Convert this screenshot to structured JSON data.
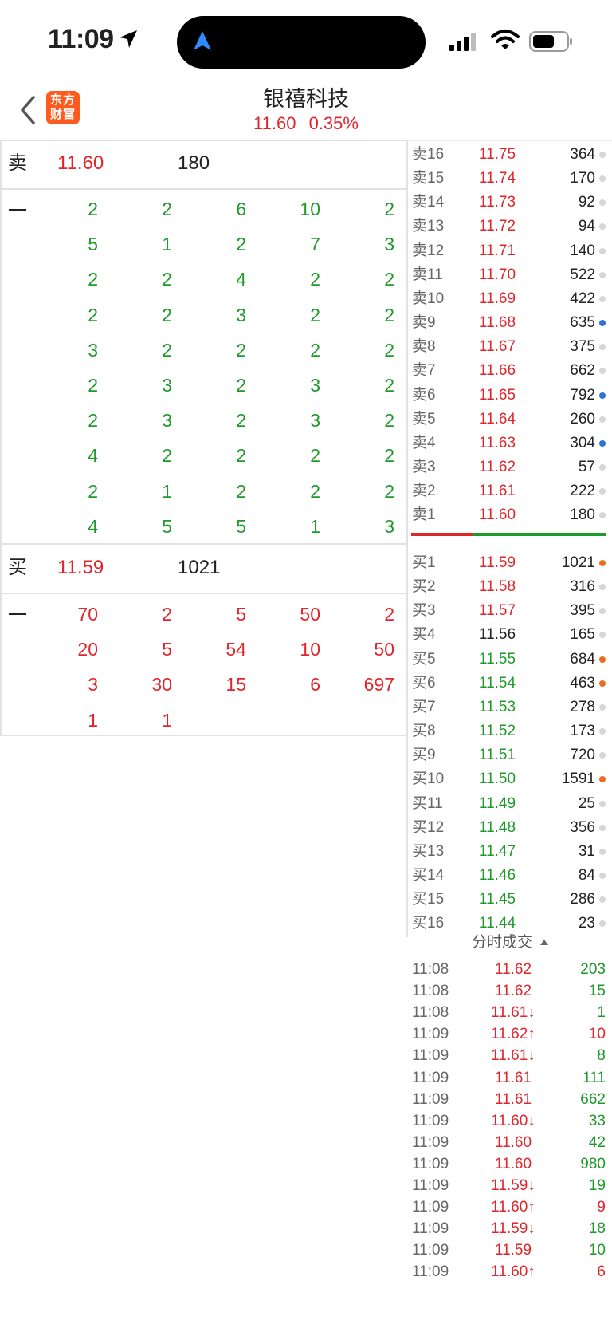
{
  "status_bar": {
    "time": "11:09"
  },
  "header": {
    "title": "银禧科技",
    "price": "11.60",
    "change_pct": "0.35%",
    "logo_line1": "东方",
    "logo_line2": "财富"
  },
  "left_panel": {
    "sell1": {
      "label": "卖一",
      "price": "11.60",
      "volume": "180",
      "orders": [
        [
          "2",
          "2",
          "6",
          "10",
          "2"
        ],
        [
          "5",
          "1",
          "2",
          "7",
          "3"
        ],
        [
          "2",
          "2",
          "4",
          "2",
          "2"
        ],
        [
          "2",
          "2",
          "3",
          "2",
          "2"
        ],
        [
          "3",
          "2",
          "2",
          "2",
          "2"
        ],
        [
          "2",
          "3",
          "2",
          "3",
          "2"
        ],
        [
          "2",
          "3",
          "2",
          "3",
          "2"
        ],
        [
          "4",
          "2",
          "2",
          "2",
          "2"
        ],
        [
          "2",
          "1",
          "2",
          "2",
          "2"
        ],
        [
          "4",
          "5",
          "5",
          "1",
          "3"
        ]
      ]
    },
    "buy1": {
      "label": "买一",
      "price": "11.59",
      "volume": "1021",
      "orders": [
        [
          "70",
          "2",
          "5",
          "50",
          "2"
        ],
        [
          "20",
          "5",
          "54",
          "10",
          "50"
        ],
        [
          "3",
          "30",
          "15",
          "6",
          "697"
        ],
        [
          "1",
          "1",
          "",
          "",
          ""
        ]
      ]
    }
  },
  "order_book": {
    "asks": [
      {
        "label": "卖16",
        "price": "11.75",
        "volume": "364",
        "dot": "gray"
      },
      {
        "label": "卖15",
        "price": "11.74",
        "volume": "170",
        "dot": "gray"
      },
      {
        "label": "卖14",
        "price": "11.73",
        "volume": "92",
        "dot": "gray"
      },
      {
        "label": "卖13",
        "price": "11.72",
        "volume": "94",
        "dot": "gray"
      },
      {
        "label": "卖12",
        "price": "11.71",
        "volume": "140",
        "dot": "gray"
      },
      {
        "label": "卖11",
        "price": "11.70",
        "volume": "522",
        "dot": "gray"
      },
      {
        "label": "卖10",
        "price": "11.69",
        "volume": "422",
        "dot": "gray"
      },
      {
        "label": "卖9",
        "price": "11.68",
        "volume": "635",
        "dot": "blue"
      },
      {
        "label": "卖8",
        "price": "11.67",
        "volume": "375",
        "dot": "gray"
      },
      {
        "label": "卖7",
        "price": "11.66",
        "volume": "662",
        "dot": "gray"
      },
      {
        "label": "卖6",
        "price": "11.65",
        "volume": "792",
        "dot": "blue"
      },
      {
        "label": "卖5",
        "price": "11.64",
        "volume": "260",
        "dot": "gray"
      },
      {
        "label": "卖4",
        "price": "11.63",
        "volume": "304",
        "dot": "blue"
      },
      {
        "label": "卖3",
        "price": "11.62",
        "volume": "57",
        "dot": "gray"
      },
      {
        "label": "卖2",
        "price": "11.61",
        "volume": "222",
        "dot": "gray"
      },
      {
        "label": "卖1",
        "price": "11.60",
        "volume": "180",
        "dot": "gray"
      }
    ],
    "bids": [
      {
        "label": "买1",
        "price": "11.59",
        "volume": "1021",
        "dot": "orange",
        "color": "red"
      },
      {
        "label": "买2",
        "price": "11.58",
        "volume": "316",
        "dot": "gray",
        "color": "red"
      },
      {
        "label": "买3",
        "price": "11.57",
        "volume": "395",
        "dot": "gray",
        "color": "red"
      },
      {
        "label": "买4",
        "price": "11.56",
        "volume": "165",
        "dot": "gray",
        "color": "black"
      },
      {
        "label": "买5",
        "price": "11.55",
        "volume": "684",
        "dot": "orange",
        "color": "green"
      },
      {
        "label": "买6",
        "price": "11.54",
        "volume": "463",
        "dot": "orange",
        "color": "green"
      },
      {
        "label": "买7",
        "price": "11.53",
        "volume": "278",
        "dot": "gray",
        "color": "green"
      },
      {
        "label": "买8",
        "price": "11.52",
        "volume": "173",
        "dot": "gray",
        "color": "green"
      },
      {
        "label": "买9",
        "price": "11.51",
        "volume": "720",
        "dot": "gray",
        "color": "green"
      },
      {
        "label": "买10",
        "price": "11.50",
        "volume": "1591",
        "dot": "orange",
        "color": "green"
      },
      {
        "label": "买11",
        "price": "11.49",
        "volume": "25",
        "dot": "gray",
        "color": "green"
      },
      {
        "label": "买12",
        "price": "11.48",
        "volume": "356",
        "dot": "gray",
        "color": "green"
      },
      {
        "label": "买13",
        "price": "11.47",
        "volume": "31",
        "dot": "gray",
        "color": "green"
      },
      {
        "label": "买14",
        "price": "11.46",
        "volume": "84",
        "dot": "gray",
        "color": "green"
      },
      {
        "label": "买15",
        "price": "11.45",
        "volume": "286",
        "dot": "gray",
        "color": "green"
      },
      {
        "label": "买16",
        "price": "11.44",
        "volume": "23",
        "dot": "gray",
        "color": "green"
      }
    ]
  },
  "ticks": {
    "header": "分时成交",
    "rows": [
      {
        "time": "11:08",
        "price": "11.62",
        "vol": "203",
        "vcolor": "green"
      },
      {
        "time": "11:08",
        "price": "11.62",
        "vol": "15",
        "vcolor": "green"
      },
      {
        "time": "11:08",
        "price": "11.61↓",
        "vol": "1",
        "vcolor": "green"
      },
      {
        "time": "11:09",
        "price": "11.62↑",
        "vol": "10",
        "vcolor": "red"
      },
      {
        "time": "11:09",
        "price": "11.61↓",
        "vol": "8",
        "vcolor": "green"
      },
      {
        "time": "11:09",
        "price": "11.61",
        "vol": "111",
        "vcolor": "green"
      },
      {
        "time": "11:09",
        "price": "11.61",
        "vol": "662",
        "vcolor": "green"
      },
      {
        "time": "11:09",
        "price": "11.60↓",
        "vol": "33",
        "vcolor": "green"
      },
      {
        "time": "11:09",
        "price": "11.60",
        "vol": "42",
        "vcolor": "green"
      },
      {
        "time": "11:09",
        "price": "11.60",
        "vol": "980",
        "vcolor": "green"
      },
      {
        "time": "11:09",
        "price": "11.59↓",
        "vol": "19",
        "vcolor": "green"
      },
      {
        "time": "11:09",
        "price": "11.60↑",
        "vol": "9",
        "vcolor": "red"
      },
      {
        "time": "11:09",
        "price": "11.59↓",
        "vol": "18",
        "vcolor": "green"
      },
      {
        "time": "11:09",
        "price": "11.59",
        "vol": "10",
        "vcolor": "green"
      },
      {
        "time": "11:09",
        "price": "11.60↑",
        "vol": "6",
        "vcolor": "red"
      }
    ]
  }
}
